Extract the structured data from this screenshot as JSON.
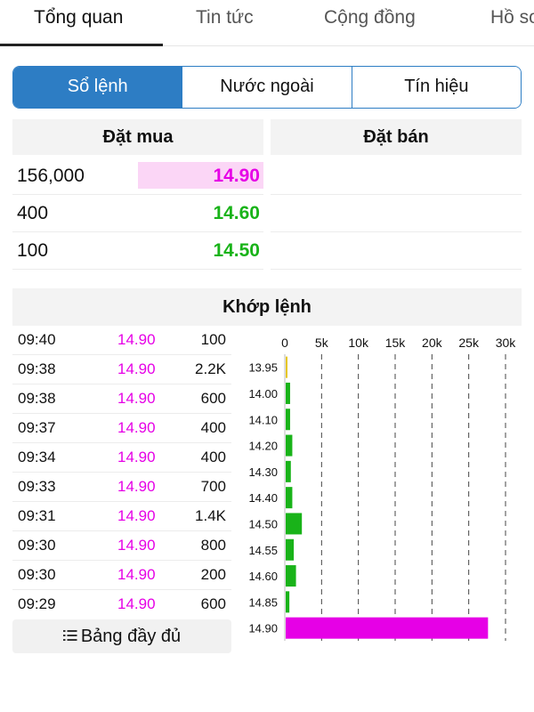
{
  "top_tabs": [
    {
      "label": "Tổng quan",
      "active": true
    },
    {
      "label": "Tin tức",
      "active": false
    },
    {
      "label": "Cộng đồng",
      "active": false
    },
    {
      "label": "Hồ sơ",
      "active": false
    }
  ],
  "segments": [
    {
      "label": "Sổ lệnh",
      "active": true
    },
    {
      "label": "Nước ngoài",
      "active": false
    },
    {
      "label": "Tín hiệu",
      "active": false
    }
  ],
  "order_book": {
    "buy_header": "Đặt mua",
    "sell_header": "Đặt bán",
    "bids": [
      {
        "volume": "156,000",
        "price": "14.90",
        "color": "#e600e6",
        "highlight": true
      },
      {
        "volume": "400",
        "price": "14.60",
        "color": "#19b319",
        "highlight": false
      },
      {
        "volume": "100",
        "price": "14.50",
        "color": "#19b319",
        "highlight": false
      }
    ]
  },
  "matched": {
    "title": "Khớp lệnh",
    "trades": [
      {
        "time": "09:40",
        "price": "14.90",
        "volume": "100"
      },
      {
        "time": "09:38",
        "price": "14.90",
        "volume": "2.2K"
      },
      {
        "time": "09:38",
        "price": "14.90",
        "volume": "600"
      },
      {
        "time": "09:37",
        "price": "14.90",
        "volume": "400"
      },
      {
        "time": "09:34",
        "price": "14.90",
        "volume": "400"
      },
      {
        "time": "09:33",
        "price": "14.90",
        "volume": "700"
      },
      {
        "time": "09:31",
        "price": "14.90",
        "volume": "1.4K"
      },
      {
        "time": "09:30",
        "price": "14.90",
        "volume": "800"
      },
      {
        "time": "09:30",
        "price": "14.90",
        "volume": "200"
      },
      {
        "time": "09:29",
        "price": "14.90",
        "volume": "600"
      }
    ],
    "full_table_label": "Bảng đầy đủ",
    "full_table_icon": "list-icon"
  },
  "colors": {
    "accent": "#2d7dc4",
    "up": "#19b319",
    "ceiling": "#e600e6",
    "reference": "#e6c619"
  },
  "chart_data": {
    "type": "bar",
    "orientation": "horizontal",
    "categories": [
      "13.95",
      "14.00",
      "14.10",
      "14.20",
      "14.30",
      "14.40",
      "14.50",
      "14.55",
      "14.60",
      "14.85",
      "14.90"
    ],
    "values": [
      150,
      600,
      600,
      900,
      700,
      900,
      2200,
      1100,
      1400,
      500,
      27500
    ],
    "bar_colors": [
      "#e6c619",
      "#19b319",
      "#19b319",
      "#19b319",
      "#19b319",
      "#19b319",
      "#19b319",
      "#19b319",
      "#19b319",
      "#19b319",
      "#e600e6"
    ],
    "x_ticks": [
      "0",
      "5k",
      "10k",
      "15k",
      "20k",
      "25k",
      "30k"
    ],
    "xlim": [
      0,
      30000
    ],
    "grid": true,
    "title": "",
    "xlabel": "",
    "ylabel": ""
  }
}
